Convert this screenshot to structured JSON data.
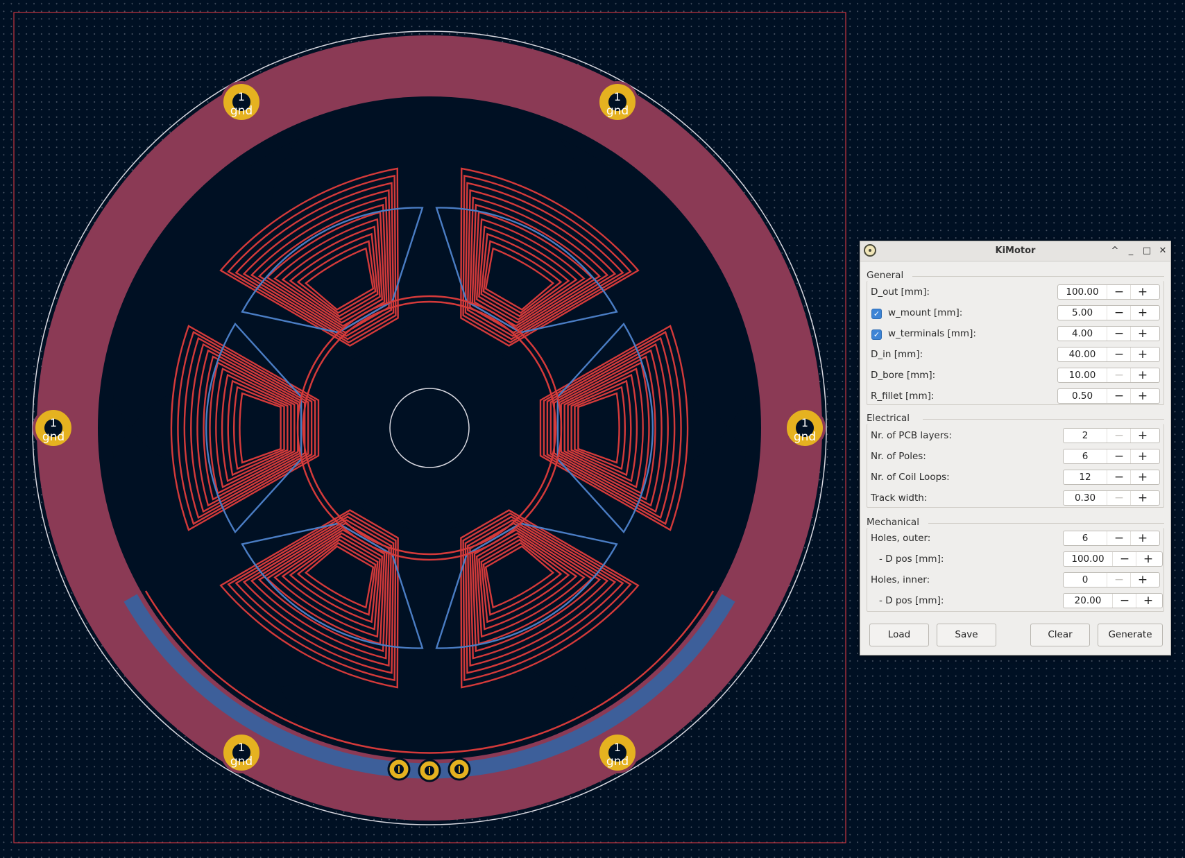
{
  "window_title": "KiMotor",
  "title_buttons": {
    "collapse": "^",
    "minimize": "_",
    "maximize": "□",
    "close": "✕"
  },
  "pad_labels": {
    "number": "1",
    "net": "gnd"
  },
  "groups": {
    "general": "General",
    "electrical": "Electrical",
    "mechanical": "Mechanical"
  },
  "fields": {
    "d_out": {
      "label": "D_out [mm]:",
      "value": "100.00"
    },
    "w_mount": {
      "label": "w_mount [mm]:",
      "value": "5.00",
      "checked": true
    },
    "w_terminals": {
      "label": "w_terminals [mm]:",
      "value": "4.00",
      "checked": true
    },
    "d_in": {
      "label": "D_in [mm]:",
      "value": "40.00"
    },
    "d_bore": {
      "label": "D_bore [mm]:",
      "value": "10.00"
    },
    "r_fillet": {
      "label": "R_fillet [mm]:",
      "value": "0.50"
    },
    "pcb_layers": {
      "label": "Nr. of PCB layers:",
      "value": "2"
    },
    "poles": {
      "label": "Nr. of Poles:",
      "value": "6"
    },
    "coil_loops": {
      "label": "Nr. of Coil Loops:",
      "value": "12"
    },
    "track_width": {
      "label": "Track width:",
      "value": "0.30"
    },
    "holes_outer": {
      "label": "Holes, outer:",
      "value": "6"
    },
    "holes_outer_dpos": {
      "label": "- D pos [mm]:",
      "value": "100.00"
    },
    "holes_inner": {
      "label": "Holes, inner:",
      "value": "0"
    },
    "holes_inner_dpos": {
      "label": "- D pos [mm]:",
      "value": "20.00"
    }
  },
  "spin_symbols": {
    "minus": "−",
    "plus": "+"
  },
  "buttons": {
    "load": "Load",
    "save": "Save",
    "clear": "Clear",
    "generate": "Generate"
  },
  "colors": {
    "background": "#001023",
    "board_fill": "#8b3a55",
    "front_copper": "#d43a3a",
    "back_copper": "#4a7dc4",
    "pad_gold": "#e5b220",
    "edge_cuts": "#c7363f"
  }
}
